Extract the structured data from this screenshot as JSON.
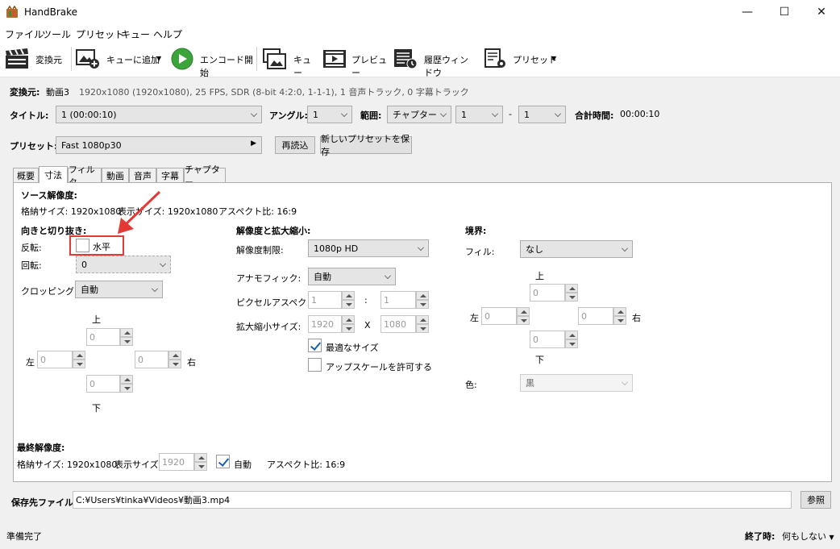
{
  "window": {
    "title": "HandBrake"
  },
  "menu": [
    "ファイル",
    "ツール",
    "プリセット",
    "キュー",
    "ヘルプ"
  ],
  "toolbar": {
    "source": "変換元",
    "add_queue": "キューに追加",
    "start": "エンコード開始",
    "queue": "キュー",
    "preview": "プレビュー",
    "activity": "履歴ウィンドウ",
    "presets": "プリセット"
  },
  "source": {
    "label": "変換元:",
    "name": "動画3",
    "info": "1920x1080 (1920x1080), 25 FPS, SDR (8-bit 4:2:0, 1-1-1), 1 音声トラック, 0 字幕トラック"
  },
  "title_row": {
    "title_label": "タイトル:",
    "title_value": "1  (00:00:10)",
    "angle_label": "アングル:",
    "angle_value": "1",
    "range_label": "範囲:",
    "range_type": "チャプター",
    "range_start": "1",
    "range_sep": "-",
    "range_end": "1",
    "duration_label": "合計時間:",
    "duration_value": "00:00:10"
  },
  "preset_row": {
    "label": "プリセット:",
    "value": "Fast 1080p30",
    "reload": "再読込",
    "save_new": "新しいプリセットを保存"
  },
  "tabs": [
    "概要",
    "寸法",
    "フィルタ",
    "動画",
    "音声",
    "字幕",
    "チャプター"
  ],
  "dimensions": {
    "source_title": "ソース解像度:",
    "storage_size": "格納サイズ: 1920x1080",
    "display_size": "表示サイズ: 1920x1080",
    "aspect": "アスペクト比: 16:9",
    "orientation_title": "向きと切り抜き:",
    "flip_label": "反転:",
    "flip_option": "水平",
    "rotate_label": "回転:",
    "rotate_value": "0",
    "cropping_label": "クロッピング:",
    "cropping_value": "自動",
    "crop": {
      "top_label": "上",
      "bottom_label": "下",
      "left_label": "左",
      "right_label": "右",
      "top": "0",
      "bottom": "0",
      "left": "0",
      "right": "0"
    },
    "resolution_title": "解像度と拡大縮小:",
    "res_limit_label": "解像度制限:",
    "res_limit_value": "1080p HD",
    "anamorphic_label": "アナモフィック:",
    "anamorphic_value": "自動",
    "par_label": "ピクセルアスペクト比:",
    "par_x": "1",
    "par_sep": ":",
    "par_y": "1",
    "scaled_label": "拡大縮小サイズ:",
    "scaled_w": "1920",
    "scaled_x": "X",
    "scaled_h": "1080",
    "optimal_label": "最適なサイズ",
    "upscale_label": "アップスケールを許可する",
    "borders_title": "境界:",
    "fill_label": "フィル:",
    "fill_value": "なし",
    "border": {
      "top_label": "上",
      "bottom_label": "下",
      "left_label": "左",
      "right_label": "右",
      "top": "0",
      "bottom": "0",
      "left": "0",
      "right": "0"
    },
    "color_label": "色:",
    "color_value": "黒",
    "final_title": "最終解像度:",
    "final_storage": "格納サイズ: 1920x1080",
    "final_display_label": "表示サイズ:",
    "final_display_value": "1920",
    "final_auto": "自動",
    "final_aspect": "アスペクト比: 16:9"
  },
  "destination": {
    "label": "保存先ファイル:",
    "path": "C:¥Users¥tinka¥Videos¥動画3.mp4",
    "browse": "参照"
  },
  "status": {
    "text": "準備完了",
    "when_done_label": "終了時:",
    "when_done_value": "何もしない"
  },
  "colors": {
    "annotation": "#e53935",
    "play": "#3ba53b",
    "check": "#1a5fb4"
  }
}
